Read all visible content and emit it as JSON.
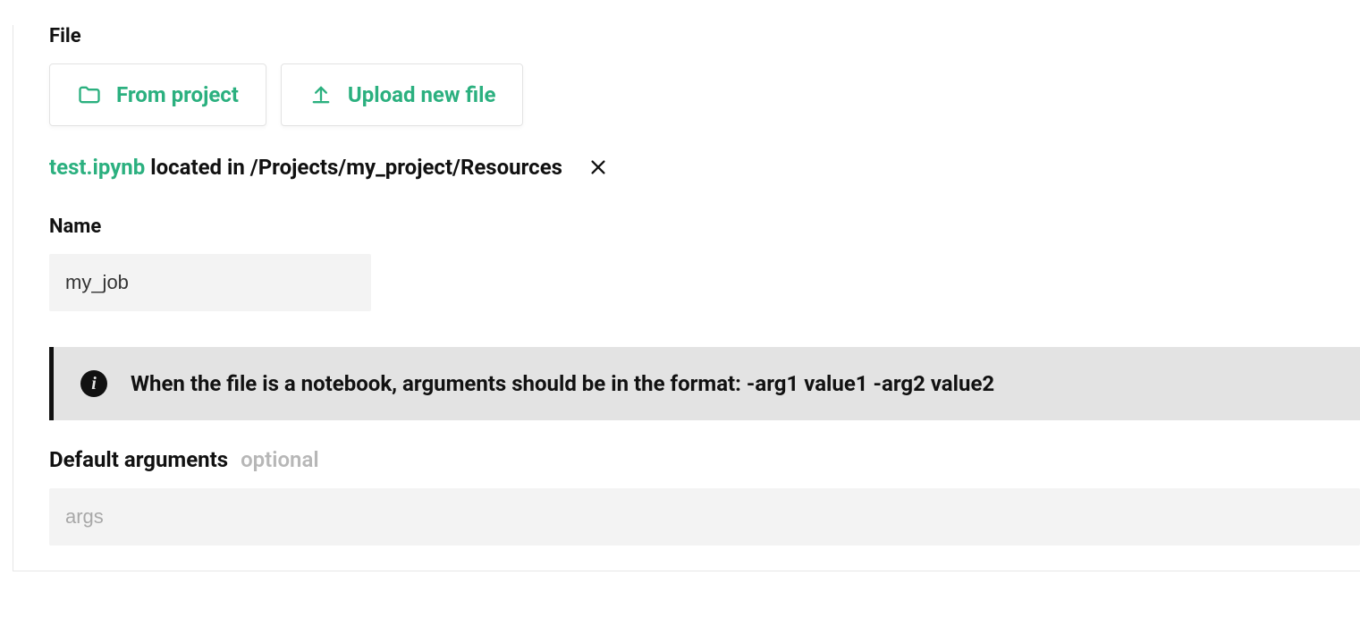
{
  "labels": {
    "file": "File",
    "name": "Name",
    "default_args": "Default arguments",
    "optional": "optional"
  },
  "buttons": {
    "from_project": "From project",
    "upload_new_file": "Upload new file"
  },
  "file": {
    "name": "test.ipynb",
    "located_text": "located in /Projects/my_project/Resources"
  },
  "inputs": {
    "name_value": "my_job",
    "args_placeholder": "args",
    "args_value": ""
  },
  "banner": {
    "message": "When the file is a notebook, arguments should be in the format: -arg1 value1 -arg2 value2"
  },
  "colors": {
    "accent": "#2bb07f",
    "banner_bg": "#e3e3e3",
    "input_bg": "#f3f3f3"
  }
}
